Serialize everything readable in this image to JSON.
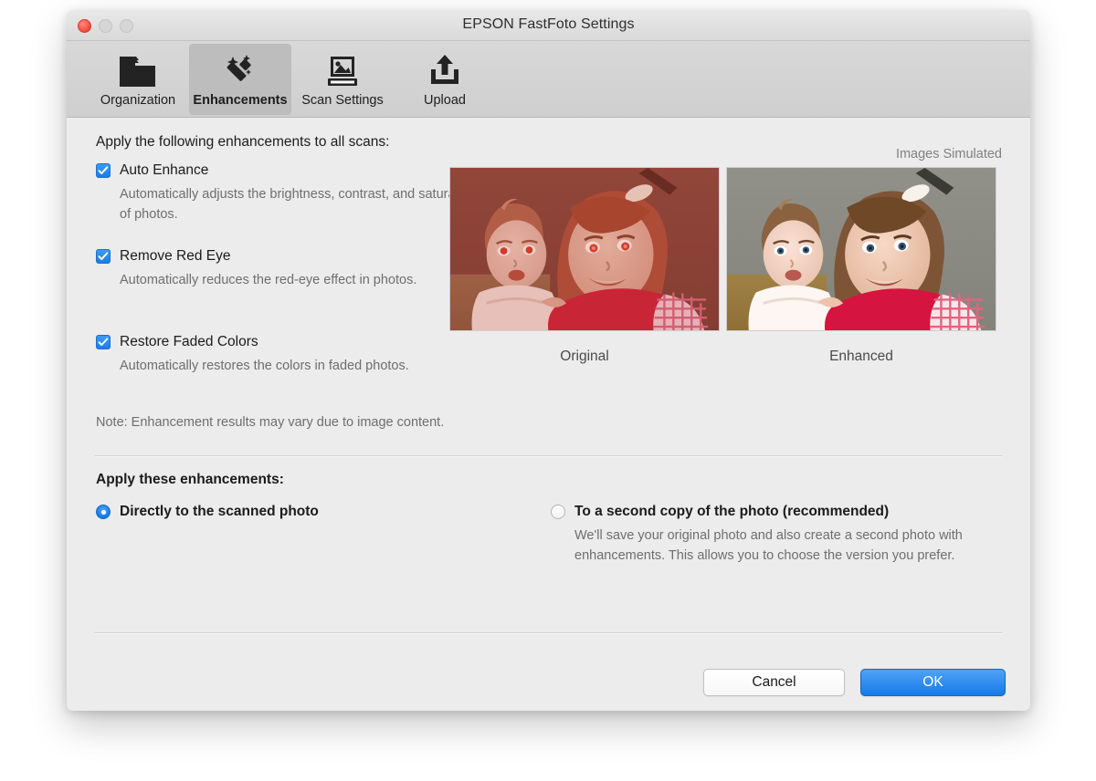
{
  "window": {
    "title": "EPSON FastFoto Settings",
    "traffic_lights": [
      {
        "name": "close",
        "color": "#f44336",
        "enabled": true
      },
      {
        "name": "minimize",
        "color": "#d6d6d6",
        "enabled": false
      },
      {
        "name": "maximize",
        "color": "#d6d6d6",
        "enabled": false
      }
    ]
  },
  "toolbar": {
    "tabs": [
      {
        "label": "Organization",
        "icon": "folder-icon",
        "selected": false
      },
      {
        "label": "Enhancements",
        "icon": "magic-wand-icon",
        "selected": true
      },
      {
        "label": "Scan Settings",
        "icon": "scanner-icon",
        "selected": false
      },
      {
        "label": "Upload",
        "icon": "upload-icon",
        "selected": false
      }
    ]
  },
  "main": {
    "section_heading": "Apply the following enhancements to all scans:",
    "images_simulated_label": "Images Simulated",
    "options": [
      {
        "label": "Auto Enhance",
        "description": "Automatically adjusts the brightness, contrast, and saturation of photos.",
        "checked": true
      },
      {
        "label": "Remove Red Eye",
        "description": "Automatically reduces the red-eye effect in photos.",
        "checked": true
      },
      {
        "label": "Restore Faded Colors",
        "description": "Automatically restores the colors in faded photos.",
        "checked": true
      }
    ],
    "note": "Note: Enhancement results may vary due to image content.",
    "previews": [
      {
        "caption": "Original",
        "alt": "Faded reddish photo of a baby and a young girl"
      },
      {
        "caption": "Enhanced",
        "alt": "Color-corrected photo of a baby and a young girl"
      }
    ],
    "apply_heading": "Apply these enhancements:",
    "apply_options": [
      {
        "label": "Directly to the scanned photo",
        "description": "",
        "selected": true
      },
      {
        "label": "To a second copy of the photo (recommended)",
        "description": "We'll save your original photo and also create a second photo with enhancements. This allows you to choose the version you prefer.",
        "selected": false
      }
    ]
  },
  "footer": {
    "cancel_label": "Cancel",
    "ok_label": "OK"
  },
  "colors": {
    "accent_blue": "#157ae8",
    "window_bg": "#ececec",
    "toolbar_bg": "#d4d4d4",
    "selected_tab_bg": "#bdbdbd",
    "text": "#1b1b1b",
    "muted_text": "#6e6e6e"
  }
}
